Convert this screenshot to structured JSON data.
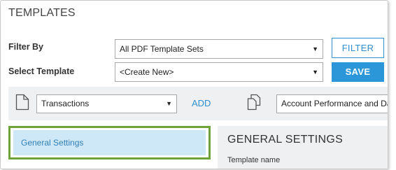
{
  "page": {
    "title": "TEMPLATES"
  },
  "filter": {
    "label": "Filter By",
    "selected": "All PDF Template Sets",
    "button": "FILTER"
  },
  "template": {
    "label": "Select Template",
    "selected": "<Create New>",
    "button": "SAVE"
  },
  "toolbar": {
    "left_select": "Transactions",
    "add_label": "ADD",
    "right_select": "Account Performance and Da"
  },
  "nav": {
    "items": [
      {
        "label": "General Settings"
      }
    ]
  },
  "section": {
    "title": "GENERAL SETTINGS",
    "field_label": "Template name"
  },
  "colors": {
    "accent": "#2b97d8",
    "highlight_border": "#6ea33a",
    "nav_selected_bg": "#cfe8f7"
  }
}
